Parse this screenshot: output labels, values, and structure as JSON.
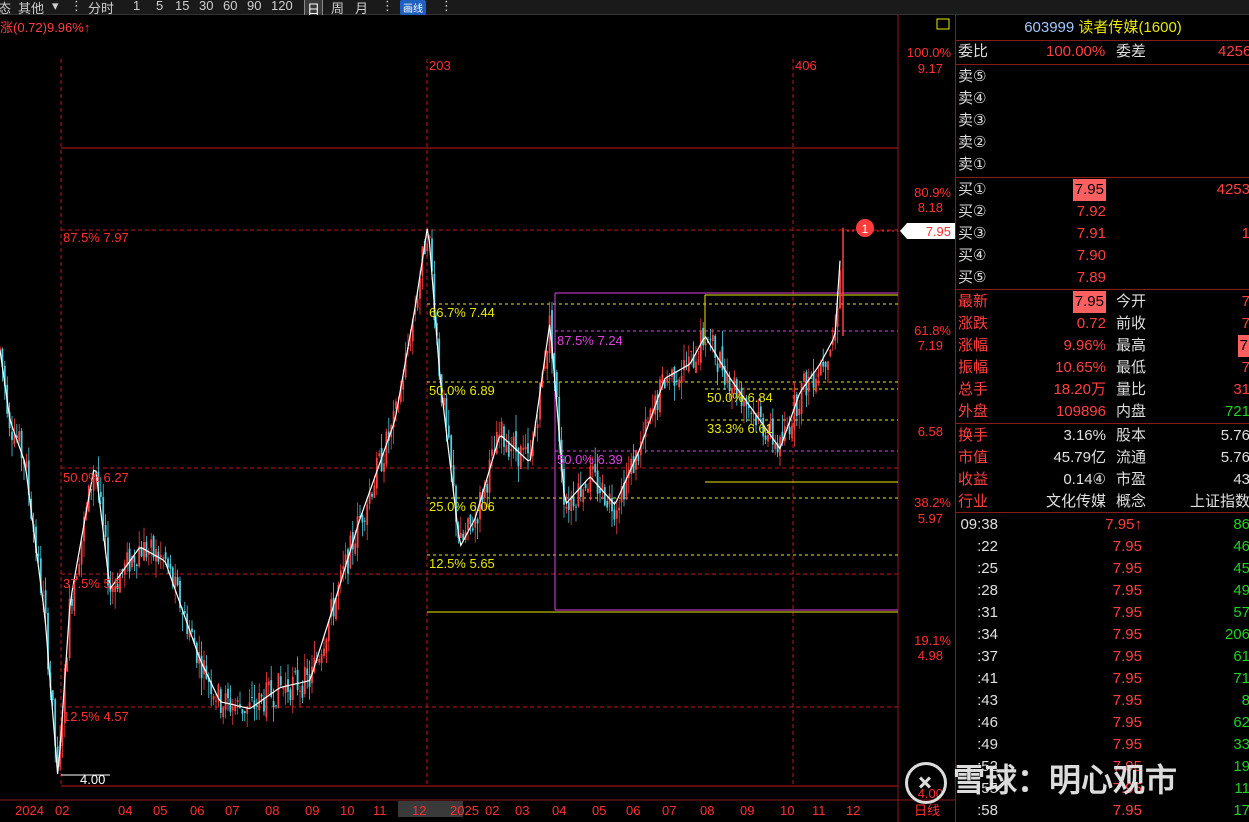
{
  "toolbar": {
    "items": [
      "态",
      "其他",
      "▾",
      "⋮",
      "分时",
      "1",
      "5",
      "15",
      "30",
      "60",
      "90",
      "120",
      "日",
      "周",
      "月",
      "⋮",
      "画线",
      "⋮"
    ],
    "active": "日"
  },
  "chart": {
    "indicator": "涨(0.72)9.96%↑",
    "bar_markers": {
      "a": "203",
      "b": "406"
    },
    "low_label": "4.00",
    "point_badge": "1",
    "current_price": "7.95",
    "fib_left": [
      {
        "label": "87.5% 7.97"
      },
      {
        "label": "50.0% 6.27"
      },
      {
        "label": "37.5% 5.5"
      },
      {
        "label": "12.5% 4.57"
      }
    ],
    "fib_mid": [
      {
        "label": "66.7% 7.44"
      },
      {
        "label": "50.0% 6.89"
      },
      {
        "label": "25.0% 6.06"
      },
      {
        "label": "12.5% 5.65"
      }
    ],
    "fib_magenta": [
      {
        "label": "87.5% 7.24"
      },
      {
        "label": "50.0% 6.39"
      }
    ],
    "fib_right": [
      {
        "label": "50.0% 6.84"
      },
      {
        "label": "33.3% 6.61"
      }
    ],
    "axis_right": [
      {
        "pct": "100.0%",
        "price": "9.17"
      },
      {
        "pct": "80.9%",
        "price": "8.18"
      },
      {
        "pct": "61.8%",
        "price": "7.19"
      },
      {
        "pct": "",
        "price": "6.58"
      },
      {
        "pct": "38.2%",
        "price": "5.97"
      },
      {
        "pct": "19.1%",
        "price": "4.98"
      },
      {
        "pct": "",
        "price": "4.00"
      }
    ],
    "x_ticks": [
      "2024",
      "02",
      "04",
      "05",
      "06",
      "07",
      "08",
      "09",
      "10",
      "11",
      "12",
      "2025",
      "02",
      "03",
      "04",
      "05",
      "06",
      "07",
      "08",
      "09",
      "10",
      "11",
      "12"
    ],
    "x_end_label": "日线"
  },
  "quote": {
    "code": "603999",
    "name": "读者传媒",
    "extra": "(1600)",
    "webi_label": "委比",
    "webi_value": "100.00%",
    "weicha_label": "委差",
    "weicha_value": "4256",
    "sell": [
      {
        "label": "卖⑤",
        "price": "",
        "vol": ""
      },
      {
        "label": "卖④",
        "price": "",
        "vol": ""
      },
      {
        "label": "卖③",
        "price": "",
        "vol": ""
      },
      {
        "label": "卖②",
        "price": "",
        "vol": ""
      },
      {
        "label": "卖①",
        "price": "",
        "vol": ""
      }
    ],
    "buy": [
      {
        "label": "买①",
        "price": "7.95",
        "vol": "4253"
      },
      {
        "label": "买②",
        "price": "7.92",
        "vol": ""
      },
      {
        "label": "买③",
        "price": "7.91",
        "vol": "1"
      },
      {
        "label": "买④",
        "price": "7.90",
        "vol": ""
      },
      {
        "label": "买⑤",
        "price": "7.89",
        "vol": ""
      }
    ],
    "stats": [
      {
        "l1": "最新",
        "v1": "7.95",
        "l2": "今开",
        "v2": "7"
      },
      {
        "l1": "涨跌",
        "v1": "0.72",
        "l2": "前收",
        "v2": "7"
      },
      {
        "l1": "涨幅",
        "v1": "9.96%",
        "l2": "最高",
        "v2": "7"
      },
      {
        "l1": "振幅",
        "v1": "10.65%",
        "l2": "最低",
        "v2": "7"
      },
      {
        "l1": "总手",
        "v1": "18.20万",
        "l2": "量比",
        "v2": "31"
      },
      {
        "l1": "外盘",
        "v1": "109896",
        "l2": "内盘",
        "v2": "721"
      }
    ],
    "info": [
      {
        "l1": "换手",
        "v1": "3.16%",
        "l2": "股本",
        "v2": "5.76"
      },
      {
        "l1": "市值",
        "v1": "45.79亿",
        "l2": "流通",
        "v2": "5.76"
      },
      {
        "l1": "收益",
        "v1": "0.14④",
        "l2": "市盈",
        "v2": "43"
      },
      {
        "l1": "行业",
        "v1": "文化传媒",
        "l2": "概念",
        "v2": "上证指数"
      }
    ],
    "ticks": [
      {
        "time": "09:38",
        "price": "7.95↑",
        "vol": "86"
      },
      {
        "time": ":22",
        "price": "7.95",
        "vol": "46"
      },
      {
        "time": ":25",
        "price": "7.95",
        "vol": "45"
      },
      {
        "time": ":28",
        "price": "7.95",
        "vol": "49"
      },
      {
        "time": ":31",
        "price": "7.95",
        "vol": "57"
      },
      {
        "time": ":34",
        "price": "7.95",
        "vol": "206"
      },
      {
        "time": ":37",
        "price": "7.95",
        "vol": "61"
      },
      {
        "time": ":41",
        "price": "7.95",
        "vol": "71"
      },
      {
        "time": ":43",
        "price": "7.95",
        "vol": "8"
      },
      {
        "time": ":46",
        "price": "7.95",
        "vol": "62"
      },
      {
        "time": ":49",
        "price": "7.95",
        "vol": "33"
      },
      {
        "time": ":52",
        "price": "7.95",
        "vol": "19"
      },
      {
        "time": ":55",
        "price": "7.95",
        "vol": "11"
      },
      {
        "time": ":58",
        "price": "7.95",
        "vol": "17"
      }
    ]
  },
  "watermark": {
    "text": "雪球：明心观市"
  },
  "colors": {
    "up": "#ff4040",
    "down": "#4fd0e0",
    "fib_red": "#ff3030",
    "fib_yellow": "#e8e800",
    "fib_magenta": "#e040e0",
    "ma": "#ffffff",
    "volume_green": "#22d022"
  },
  "chart_data": {
    "type": "candlestick",
    "x_range": [
      "2024-01",
      "2025-12"
    ],
    "ylim": [
      4.0,
      9.17
    ],
    "key_points": [
      {
        "date": "2024-02",
        "low": 4.0
      },
      {
        "date": "2024-12",
        "high": 8.2
      },
      {
        "date": "2025-12",
        "close": 7.95
      }
    ]
  }
}
